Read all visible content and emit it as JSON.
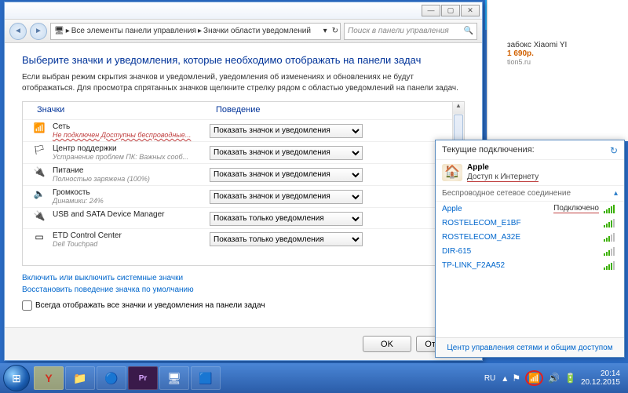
{
  "window": {
    "breadcrumb": {
      "p1": "Все элементы панели управления",
      "p2": "Значки области уведомлений"
    },
    "search_placeholder": "Поиск в панели управления",
    "heading": "Выберите значки и уведомления, которые необходимо отображать на панели задач",
    "subtext": "Если выбран режим скрытия значков и уведомлений, уведомления об изменениях и обновлениях не будут отображаться. Для просмотра спрятанных значков щелкните стрелку рядом с областью уведомлений на панели задач.",
    "col_icons": "Значки",
    "col_behavior": "Поведение",
    "rows": [
      {
        "title": "Сеть",
        "sub": "Не подключен Доступны беспроводные...",
        "sub_red": true,
        "opt": "Показать значок и уведомления"
      },
      {
        "title": "Центр поддержки",
        "sub": "Устранение проблем ПК: Важных сооб...",
        "opt": "Показать значок и уведомления"
      },
      {
        "title": "Питание",
        "sub": "Полностью заряжена (100%)",
        "opt": "Показать значок и уведомления"
      },
      {
        "title": "Громкость",
        "sub": "Динамики: 24%",
        "opt": "Показать значок и уведомления"
      },
      {
        "title": "USB and SATA Device Manager",
        "sub": "",
        "opt": "Показать только уведомления"
      },
      {
        "title": "ETD Control Center",
        "sub": "Dell Touchpad",
        "opt": "Показать только уведомления"
      }
    ],
    "link_systray": "Включить или выключить системные значки",
    "link_restore": "Восстановить поведение значка по умолчанию",
    "checkbox": "Всегда отображать все значки и уведомления на панели задач",
    "btn_ok": "OK",
    "btn_cancel": "Отмена"
  },
  "netflyout": {
    "current_label": "Текущие подключения:",
    "conn_name": "Apple",
    "conn_status": "Доступ к Интернету",
    "section": "Беспроводное сетевое соединение",
    "connected_label": "Подключено",
    "items": [
      "Apple",
      "ROSTELECOM_E1BF",
      "ROSTELECOM_A32E",
      "DIR-615",
      "TP-LINK_F2AA52"
    ],
    "footer": "Центр управления сетями и общим доступом"
  },
  "ad": {
    "line1": "забокс Xiaomi YI",
    "price": "1 690р.",
    "site": "tion5.ru"
  },
  "taskbar": {
    "lang": "RU",
    "time": "20:14",
    "date": "20.12.2015"
  }
}
